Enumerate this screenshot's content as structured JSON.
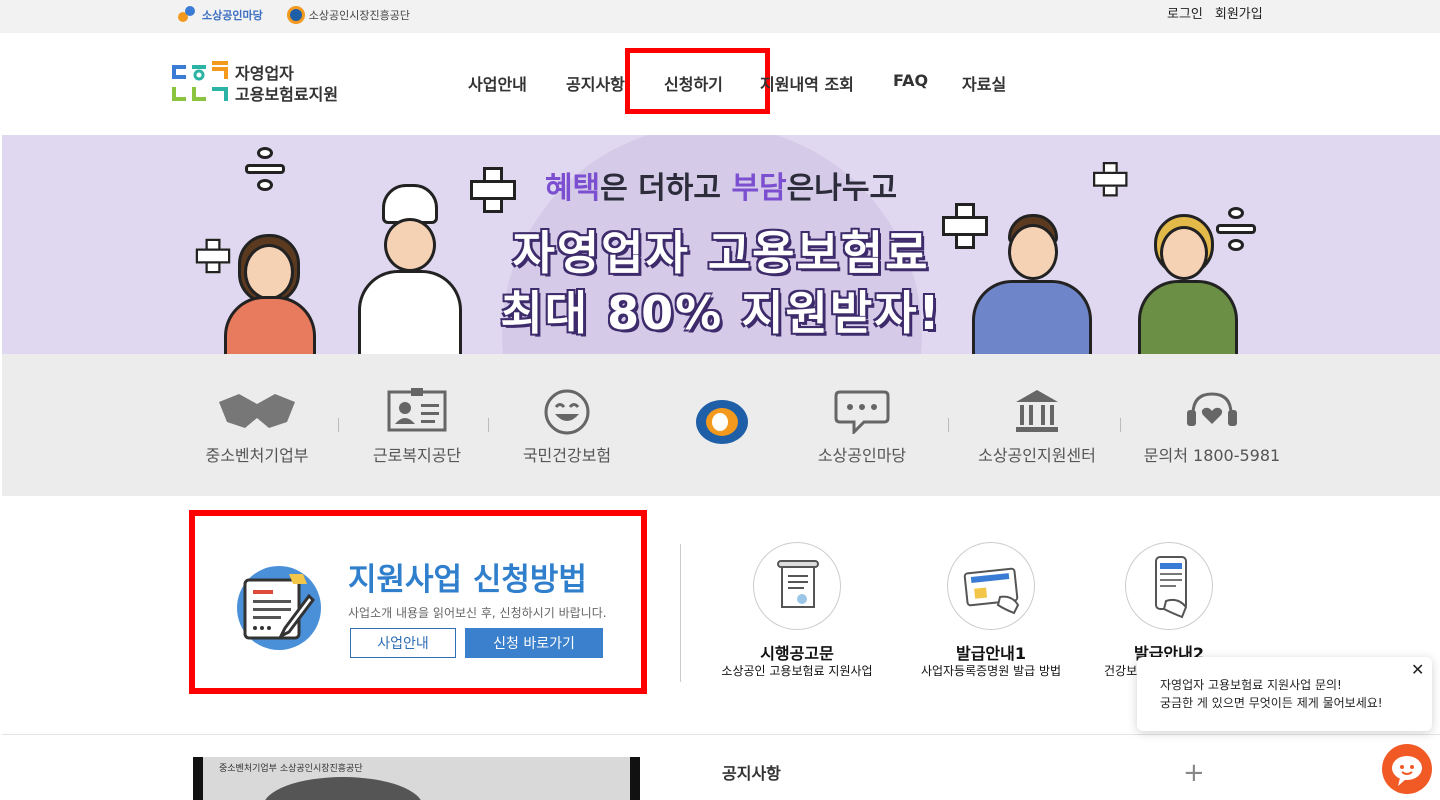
{
  "topbar": {
    "logo1_label": "소상공인마당",
    "logo2_label": "소상공인시장진흥공단",
    "login": "로그인",
    "signup": "회원가입"
  },
  "header": {
    "logo_line1": "자영업자",
    "logo_line2": "고용보험료지원",
    "nav": [
      "사업안내",
      "공지사항",
      "신청하기",
      "지원내역 조회",
      "FAQ",
      "자료실"
    ]
  },
  "banner": {
    "line1_a": "혜택",
    "line1_b": "은 더하고 ",
    "line1_c": "부담",
    "line1_d": "은나누고",
    "line2": "자영업자 고용보험료",
    "line3": "최대 80% 지원받자!"
  },
  "quicklinks": [
    "중소벤처기업부",
    "근로복지공단",
    "국민건강보험",
    "소상공인마당",
    "소상공인지원센터",
    "문의처 1800-5981"
  ],
  "apply": {
    "title": "지원사업 신청방법",
    "desc": "사업소개 내용을 읽어보신 후, 신청하시기 바랍니다.",
    "btn_info": "사업안내",
    "btn_apply": "신청 바로가기"
  },
  "cards": [
    {
      "title": "시행공고문",
      "sub": "소상공인 고용보험료 지원사업"
    },
    {
      "title": "발급안내1",
      "sub": "사업자등록증명원 발급 방법"
    },
    {
      "title": "발급안내2",
      "sub": "건강보"
    }
  ],
  "video": {
    "caption": "중소벤처기업부   소상공인시장진흥공단"
  },
  "notice": {
    "title": "공지사항",
    "plus": "+"
  },
  "chat": {
    "line1": "자영업자 고용보험료 지원사업 문의!",
    "line2": "궁금한 게 있으면 무엇이든 제게 물어보세요!",
    "close": "✕"
  },
  "colors": {
    "accent": "#2f7fcd",
    "highlight": "#ff0000",
    "chat": "#f15a24"
  }
}
